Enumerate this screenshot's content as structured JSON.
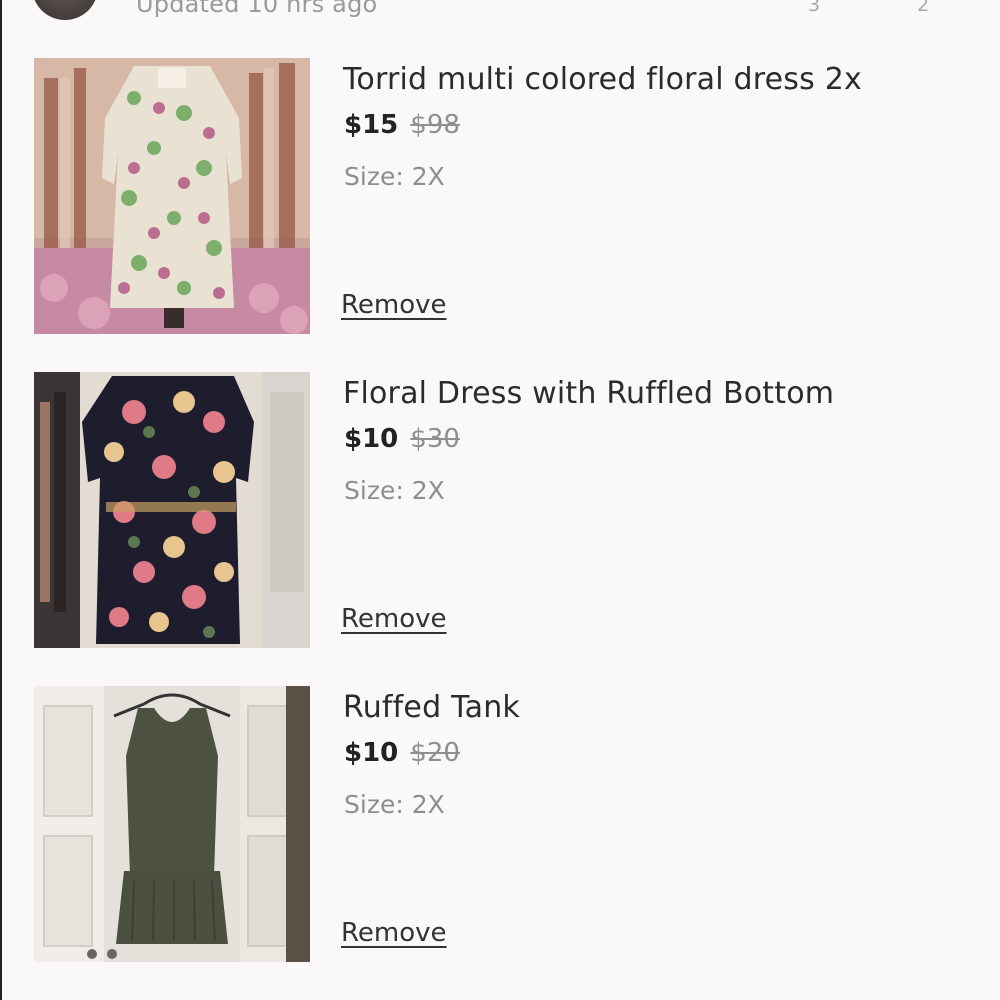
{
  "header": {
    "updated_text": "Updated 10 hrs ago",
    "count_1": "3",
    "count_2": "2"
  },
  "items": [
    {
      "title": "Torrid multi colored floral dress 2x",
      "price": "$15",
      "original_price": "$98",
      "size": "Size: 2X",
      "remove_label": "Remove",
      "image_desc": "floral-dress-photo"
    },
    {
      "title": "Floral Dress with Ruffled Bottom",
      "price": "$10",
      "original_price": "$30",
      "size": "Size: 2X",
      "remove_label": "Remove",
      "image_desc": "floral-dress-photo"
    },
    {
      "title": "Ruffed Tank",
      "price": "$10",
      "original_price": "$20",
      "size": "Size: 2X",
      "remove_label": "Remove",
      "image_desc": "tank-dress-photo"
    }
  ],
  "colors": {
    "background": "#fbf8fa",
    "text": "#2b2b2b",
    "muted": "#8e8e8e"
  }
}
